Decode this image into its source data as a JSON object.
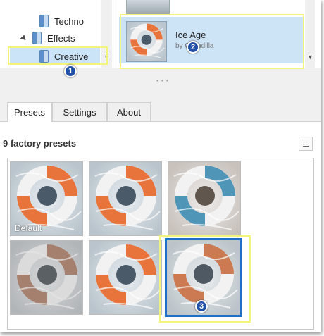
{
  "tree": {
    "items": [
      {
        "label": "Techno"
      },
      {
        "label": "Effects"
      },
      {
        "label": "Creative"
      }
    ]
  },
  "preset_list": {
    "selected": {
      "name": "Ice Age",
      "author": "by Cocadilla"
    }
  },
  "tabs": [
    {
      "label": "Presets",
      "active": true
    },
    {
      "label": "Settings",
      "active": false
    },
    {
      "label": "About",
      "active": false
    }
  ],
  "presets_panel": {
    "count_label": "9 factory presets",
    "tiles": [
      {
        "label": "Default"
      },
      {
        "label": ""
      },
      {
        "label": ""
      },
      {
        "label": ""
      },
      {
        "label": ""
      },
      {
        "label": "",
        "selected": true
      }
    ]
  },
  "callouts": [
    "1",
    "2",
    "3"
  ],
  "colors": {
    "selection": "#cde3f6",
    "accent": "#1e6fc8",
    "callout": "#f4f37c",
    "badge": "#2250a8"
  }
}
